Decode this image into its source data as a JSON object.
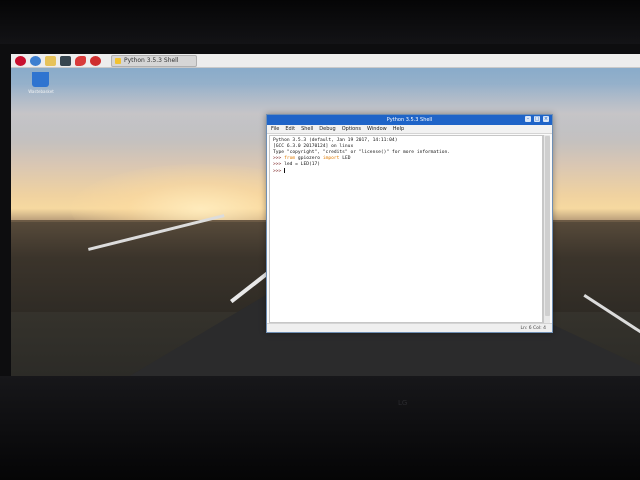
{
  "desktop": {
    "trash_label": "Wastebasket"
  },
  "taskbar": {
    "launchers": [
      "raspberry-menu-icon",
      "browser-icon",
      "file-manager-icon",
      "terminal-icon",
      "mathematica-icon",
      "wolfram-icon"
    ],
    "task_label": "Python 3.5.3 Shell"
  },
  "window": {
    "title": "Python 3.5.3 Shell",
    "menu": [
      "File",
      "Edit",
      "Shell",
      "Debug",
      "Options",
      "Window",
      "Help"
    ],
    "lines": {
      "l1": "Python 3.5.3 (default, Jan 19 2017, 14:11:04)",
      "l2": "[GCC 6.3.0 20170124] on linux",
      "l3_a": "Type \"copyright\", \"credits\" or \"license()\" for more information.",
      "l4_prompt": ">>> ",
      "l4_kw1": "from",
      "l4_mid": " gpiozero ",
      "l4_kw2": "import",
      "l4_end": " LED",
      "l5_prompt": ">>> ",
      "l5_code": "led = LED(17)",
      "l6_prompt": ">>> "
    },
    "status": "Ln: 6   Col: 4"
  },
  "monitor": {
    "brand": "LG"
  }
}
